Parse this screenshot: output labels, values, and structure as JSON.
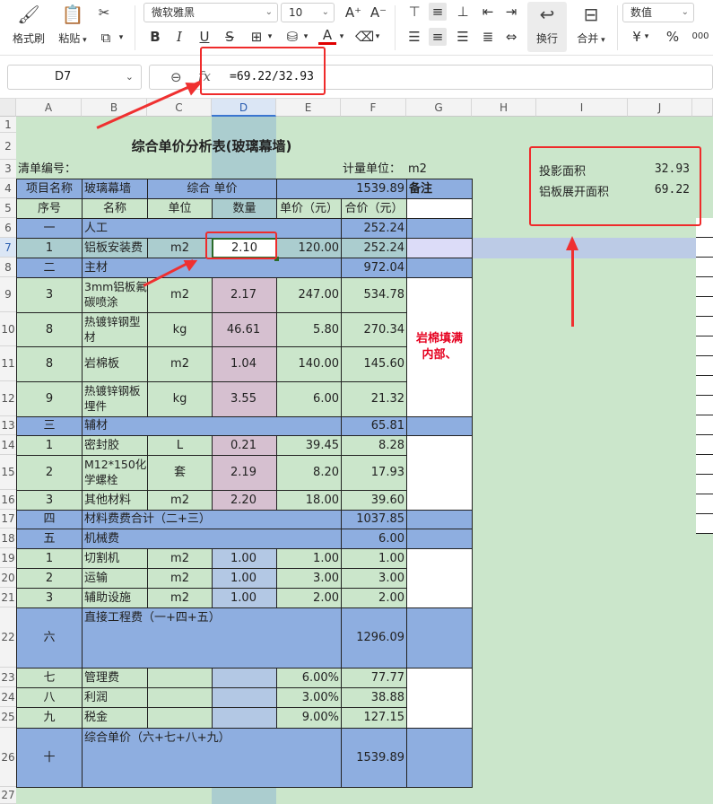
{
  "ribbon": {
    "format_painter": "格式刷",
    "paste": "粘贴",
    "font_name": "微软雅黑",
    "font_size": "10",
    "wrap": "换行",
    "merge": "合并",
    "number_format": "数值",
    "currency": "¥",
    "percent": "%",
    "thousands": "000",
    "bold": "B",
    "italic": "I",
    "underline": "U",
    "strike": "S",
    "font_color": "A",
    "grow_font": "A⁺",
    "shrink_font": "A⁻"
  },
  "formula_bar": {
    "name_box": "D7",
    "fx": "fx",
    "formula": "=69.22/32.93"
  },
  "columns": [
    "A",
    "B",
    "C",
    "D",
    "E",
    "F",
    "G",
    "H",
    "I",
    "J"
  ],
  "rows": [
    "1",
    "2",
    "3",
    "4",
    "5",
    "6",
    "7",
    "8",
    "9",
    "10",
    "11",
    "12",
    "13",
    "14",
    "15",
    "16",
    "17",
    "18",
    "19",
    "20",
    "21",
    "22",
    "23",
    "24",
    "25",
    "26",
    "27"
  ],
  "sheet": {
    "title": "综合单价分析表(玻璃幕墙)",
    "list_no_label": "清单编号：",
    "unit_label": "计量单位：",
    "unit_value": "m2",
    "project_name_label": "项目名称",
    "project_name_value": "玻璃幕墙",
    "composite_price_label": "综合 单价",
    "composite_price_value": "1539.89",
    "note_label": "备注",
    "headers": [
      "序号",
      "名称",
      "单位",
      "数量",
      "单价（元）",
      "合价（元）"
    ],
    "rows": [
      {
        "no": "一",
        "name": "人工",
        "unit": "",
        "qty": "",
        "price": "",
        "total": "252.24"
      },
      {
        "no": "1",
        "name": "铝板安装费",
        "unit": "m2",
        "qty": "2.10",
        "price": "120.00",
        "total": "252.24"
      },
      {
        "no": "二",
        "name": "主材",
        "unit": "",
        "qty": "",
        "price": "",
        "total": "972.04"
      },
      {
        "no": "3",
        "name": "3mm铝板氟碳喷涂",
        "unit": "m2",
        "qty": "2.17",
        "price": "247.00",
        "total": "534.78"
      },
      {
        "no": "8",
        "name": "热镀锌钢型材",
        "unit": "kg",
        "qty": "46.61",
        "price": "5.80",
        "total": "270.34"
      },
      {
        "no": "8",
        "name": "岩棉板",
        "unit": "m2",
        "qty": "1.04",
        "price": "140.00",
        "total": "145.60"
      },
      {
        "no": "9",
        "name": "热镀锌钢板埋件",
        "unit": "kg",
        "qty": "3.55",
        "price": "6.00",
        "total": "21.32"
      },
      {
        "no": "三",
        "name": "辅材",
        "unit": "",
        "qty": "",
        "price": "",
        "total": "65.81"
      },
      {
        "no": "1",
        "name": "密封胶",
        "unit": "L",
        "qty": "0.21",
        "price": "39.45",
        "total": "8.28"
      },
      {
        "no": "2",
        "name": "M12*150化学螺栓",
        "unit": "套",
        "qty": "2.19",
        "price": "8.20",
        "total": "17.93"
      },
      {
        "no": "3",
        "name": "其他材料",
        "unit": "m2",
        "qty": "2.20",
        "price": "18.00",
        "total": "39.60"
      },
      {
        "no": "四",
        "name": "材料费费合计（二+三）",
        "unit": "",
        "qty": "",
        "price": "",
        "total": "1037.85"
      },
      {
        "no": "五",
        "name": "机械费",
        "unit": "",
        "qty": "",
        "price": "",
        "total": "6.00"
      },
      {
        "no": "1",
        "name": "切割机",
        "unit": "m2",
        "qty": "1.00",
        "price": "1.00",
        "total": "1.00"
      },
      {
        "no": "2",
        "name": "运输",
        "unit": "m2",
        "qty": "1.00",
        "price": "3.00",
        "total": "3.00"
      },
      {
        "no": "3",
        "name": "辅助设施",
        "unit": "m2",
        "qty": "1.00",
        "price": "2.00",
        "total": "2.00"
      },
      {
        "no": "六",
        "name": "直接工程费（一+四+五）",
        "unit": "",
        "qty": "",
        "price": "",
        "total": "1296.09"
      },
      {
        "no": "七",
        "name": "管理费",
        "unit": "",
        "qty": "",
        "price": "6.00%",
        "total": "77.77"
      },
      {
        "no": "八",
        "name": "利润",
        "unit": "",
        "qty": "",
        "price": "3.00%",
        "total": "38.88"
      },
      {
        "no": "九",
        "name": "税金",
        "unit": "",
        "qty": "",
        "price": "9.00%",
        "total": "127.15"
      },
      {
        "no": "十",
        "name": "综合单价（六+七+八+九）",
        "unit": "",
        "qty": "",
        "price": "",
        "total": "1539.89"
      }
    ],
    "note_text": "岩棉填满内部、",
    "side_box": {
      "proj_area_label": "投影面积",
      "proj_area_value": "32.93",
      "unfold_area_label": "铝板展开面积",
      "unfold_area_value": "69.22"
    }
  },
  "colors": {
    "sheet_bg": "#cbe6cb",
    "header_blue": "#8eaee0",
    "qty_pink": "#d6c0d0",
    "annotation_red": "#ef2b2b",
    "note_red": "#e5001f"
  }
}
